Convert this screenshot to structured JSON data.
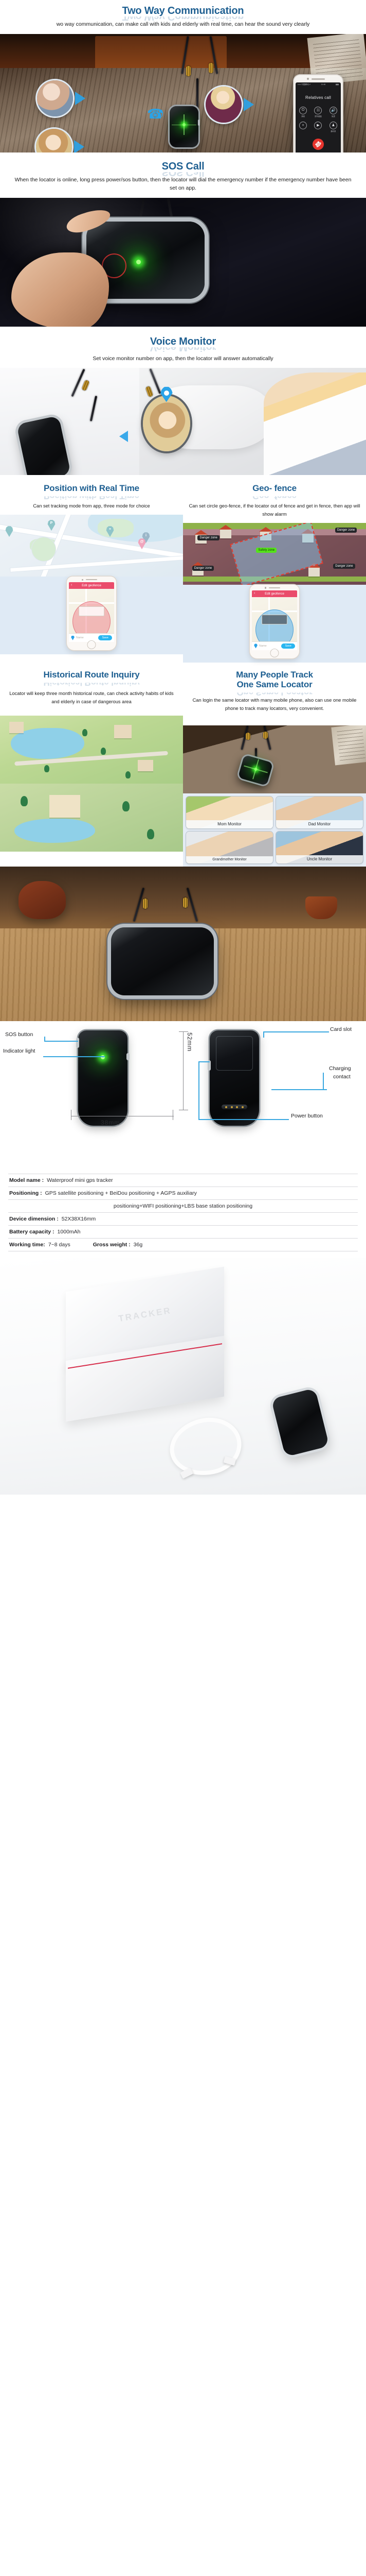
{
  "sections": {
    "two_way": {
      "title": "Two Way Communication",
      "desc": "wo way communication, can make call with kids and elderly with real time, can hear the sound very clearly",
      "phone": {
        "caller_label": "Relatives call",
        "status_left": "••••• 中国移动 ✔",
        "status_time": "11:46",
        "status_right": "▮▮▮",
        "buttons": [
          {
            "icon": "mute-icon",
            "glyph": "⚇",
            "label": "静音"
          },
          {
            "icon": "keypad-icon",
            "glyph": "∷",
            "label": "拨号键盘"
          },
          {
            "icon": "speaker-icon",
            "glyph": "◂))",
            "label": "免提"
          },
          {
            "icon": "add-call-icon",
            "glyph": "+",
            "label": ""
          },
          {
            "icon": "video-icon",
            "glyph": "■▸",
            "label": ""
          },
          {
            "icon": "contacts-icon",
            "glyph": "♟",
            "label": "通讯录"
          }
        ],
        "end_call_icon": "end-call-icon"
      }
    },
    "sos": {
      "title": "SOS Call",
      "desc": "When the locator is online, long press power/sos button, then the locator will dial the emergency number if the emergency number have been set on app."
    },
    "voice_monitor": {
      "title": "Voice Monitor",
      "desc": "Set voice monitor number on app, then the locator will  answer automatically"
    },
    "position": {
      "title": "Position with Real Time",
      "desc": "Can set tracking mode from app, three mode for choice",
      "app": {
        "bar_title": "Edit geofence",
        "back_icon": "back-chevron-icon",
        "input_placeholder": "Name",
        "save_label": "Save"
      },
      "map_pins": [
        "P",
        "+",
        "i",
        "@"
      ]
    },
    "geofence": {
      "title": "Geo- fence",
      "desc": "Can set circle geo-fence, if the locator out of fence and get in fence, then app will show alarm",
      "tags": {
        "safety": "Safety zone",
        "danger": "Danger zone"
      },
      "app": {
        "bar_title": "Edit geofence",
        "back_icon": "back-chevron-icon",
        "input_placeholder": "Name",
        "save_label": "Save"
      }
    },
    "history": {
      "title": "Historical Route Inquiry",
      "desc": "Locator will keep three month historical route, can check activity habits of kids and elderly in case of dangerous area"
    },
    "many_people": {
      "title_line1": "Many People Track",
      "title_line2": "One Same Locator",
      "desc": "Can login the same locator with many mobile phone, also can use one mobile phone to track many locators, very convenient.",
      "monitors": [
        {
          "label": "Mom Monitor",
          "key": "mom"
        },
        {
          "label": "Dad Monitor",
          "key": "dad"
        },
        {
          "label": "Grandmother Monitor",
          "key": "gma"
        },
        {
          "label": "Uncle Monitor",
          "key": "uncle"
        }
      ]
    },
    "diagram": {
      "callouts": {
        "sos_button": "SOS button",
        "indicator_light": "Indicator light",
        "card_slot": "Card slot",
        "charging_contact_line1": "Charging",
        "charging_contact_line2": "contact",
        "power_button": "Power button"
      },
      "dimensions": {
        "height": "52mm",
        "width": "38mm"
      }
    },
    "specs": {
      "rows": [
        {
          "key": "Model name :",
          "value": "Waterproof mini gps tracker"
        },
        {
          "key": "Positioning :",
          "value": "GPS satellite positioning + BeiDou positioning + AGPS auxiliary"
        },
        {
          "key": "",
          "value": "positioning+WIFI positioning+LBS base station positioning",
          "continuation": true
        },
        {
          "key": "Device dimension :",
          "value": "52X38X16mm"
        },
        {
          "key": "Battery capacity :",
          "value": "1000mAh"
        }
      ],
      "last_row": [
        {
          "key": "Working time:",
          "value": "7~8 days"
        },
        {
          "key": "Gross weight :",
          "value": "36g"
        }
      ]
    },
    "package": {
      "box_text": "TRACKER"
    }
  },
  "colors": {
    "heading_blue": "#1e5f91",
    "accent_cyan": "#2aa3e8",
    "app_bar_pink": "#ea4c6b",
    "save_blue": "#29b6f0",
    "led_green": "#7dff5a",
    "end_call_red": "#e8342d",
    "danger_red": "#e23b2e",
    "safety_green": "#55e21a",
    "package_red": "#d62b49"
  }
}
